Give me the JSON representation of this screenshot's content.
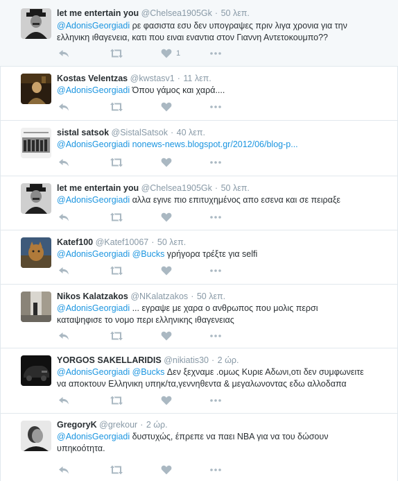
{
  "tweets": [
    {
      "name": "let me entertain you",
      "handle": "@Chelsea1905Gk",
      "time": "50 λεπ.",
      "mention": "@AdonisGeorgiadi",
      "line1_rest": " ρε φασιστα εσυ δεν υπογραψες πριν λιγα χρονια για την",
      "line2": "ελληνικη ιθαγενεια, κατι που ειναι εναντια στον Γιαννη Αντετοκουμπο??",
      "like_count": "1",
      "avatar": "man-with-hat"
    },
    {
      "name": "Kostas Velentzas",
      "handle": "@kwstasv1",
      "time": "11 λεπ.",
      "mention": "@AdonisGeorgiadi",
      "line1_rest": " Όπου γάμος και χαρά....",
      "avatar": "dark-figure"
    },
    {
      "name": "sistal satsok",
      "handle": "@SistalSatsok",
      "time": "40 λεπ.",
      "mention": "@AdonisGeorgiadi",
      "link": "nonews-news.blogspot.gr/2012/06/blog-p...",
      "avatar": "group-photo"
    },
    {
      "name": "let me entertain you",
      "handle": "@Chelsea1905Gk",
      "time": "50 λεπ.",
      "mention": "@AdonisGeorgiadi",
      "line1_rest": " αλλα εγινε πιο επιτυχημένος απο εσενα και σε πειραξε",
      "avatar": "man-with-hat"
    },
    {
      "name": "Katef100",
      "handle": "@Katef10067",
      "time": "50 λεπ.",
      "mention": "@AdonisGeorgiadi",
      "mention2": "@Bucks",
      "line1_rest": " γρήγορα τρέξτε για selfi",
      "avatar": "cat"
    },
    {
      "name": "Nikos Kalatzakos",
      "handle": "@NKalatzakos",
      "time": "50 λεπ.",
      "mention": "@AdonisGeorgiadi",
      "line1_rest": " ... εγραψε με χαρα ο ανθρωπος που μολις περσι",
      "line2": "καταψηφισε το νομο περι ελληνικης ιθαγενειας",
      "avatar": "street"
    },
    {
      "name": "YORGOS SAKELLARIDIS",
      "handle": "@nikiatis30",
      "time": "2 ώρ.",
      "mention": "@AdonisGeorgiadi",
      "mention2": "@Bucks",
      "line1_rest": " Δεν ξεχναμε .ομως Κυριε Αδωνι,οτι δεν συμφωνειτε",
      "line2": "να αποκτουν Ελληνικη υπηκ/τα,γεννηθεντα & μεγαλωνοντας εδω αλλοδαπα",
      "avatar": "dark-car"
    },
    {
      "name": "GregoryK",
      "handle": "@grekour",
      "time": "2 ώρ.",
      "mention": "@AdonisGeorgiadi",
      "line1_rest": " δυστυχώς, έπρεπε να παει NBA για να του δώσουν",
      "line2": "υπηκοότητα.",
      "avatar": "portrait-bw"
    }
  ],
  "colors": {
    "link": "#1b95e0",
    "muted": "#8899a6",
    "text": "#292f33",
    "divider": "#e1e8ed",
    "highlight": "#f5f8fa"
  },
  "icons": {
    "reply": "reply-icon",
    "retweet": "retweet-icon",
    "like": "heart-icon",
    "more": "more-icon"
  }
}
